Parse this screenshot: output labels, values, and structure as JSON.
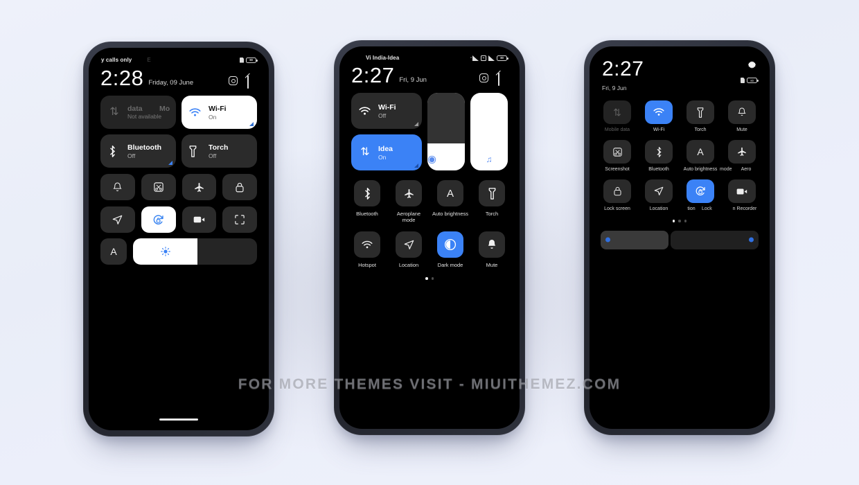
{
  "watermark": "FOR MORE THEMES VISIT - MIUITHEMEZ.COM",
  "phone1": {
    "statusbar": {
      "carrier": "y calls only",
      "ghost": "E",
      "battery_text": "80"
    },
    "header": {
      "time": "2:28",
      "date": "Friday, 09 June",
      "settings_icon": "hexagon-settings-icon",
      "edit_icon": "edit-icon"
    },
    "big_tiles": [
      {
        "name": "mobile-data",
        "ghost_a": "data",
        "ghost_b": "Mo",
        "title": "Mobile data",
        "subtitle": "Not available",
        "state": "dim",
        "icon": "data-arrows-icon",
        "corner": false
      },
      {
        "name": "wifi",
        "title": "Wi-Fi",
        "subtitle": "On",
        "state": "on-white",
        "icon": "wifi-icon",
        "corner": true
      },
      {
        "name": "bluetooth",
        "title": "Bluetooth",
        "subtitle": "Off",
        "state": "off",
        "icon": "bluetooth-icon",
        "corner": true
      },
      {
        "name": "torch",
        "title": "Torch",
        "subtitle": "Off",
        "state": "off",
        "icon": "torch-icon",
        "corner": false
      }
    ],
    "square_tiles": [
      {
        "name": "mute",
        "icon": "bell-icon",
        "on": false
      },
      {
        "name": "screenshot",
        "icon": "screenshot-icon",
        "on": false
      },
      {
        "name": "aeroplane-mode",
        "icon": "airplane-icon",
        "on": false
      },
      {
        "name": "lock-screen",
        "icon": "lock-icon",
        "on": false
      },
      {
        "name": "location",
        "icon": "location-arrow-icon",
        "on": false
      },
      {
        "name": "screen-rotation-lock",
        "icon": "rotation-lock-icon",
        "on": true
      },
      {
        "name": "screen-recorder",
        "icon": "video-camera-icon",
        "on": false
      },
      {
        "name": "scan",
        "icon": "scan-frame-icon",
        "on": false
      }
    ],
    "brightness": {
      "auto_label": "A",
      "icon": "brightness-icon",
      "fill_percent": 52
    }
  },
  "phone2": {
    "statusbar": {
      "carrier": "Vi India-Idea",
      "battery_text": "80"
    },
    "header": {
      "time": "2:27",
      "date": "Fri, 9 Jun",
      "settings_icon": "hexagon-settings-icon",
      "edit_icon": "edit-icon"
    },
    "big_tiles": [
      {
        "name": "wifi",
        "title": "Wi-Fi",
        "subtitle": "Off",
        "state": "off",
        "icon": "wifi-icon",
        "corner": true
      },
      {
        "name": "mobile-data-idea",
        "title": "Idea",
        "subtitle": "On",
        "state": "on-blue",
        "icon": "data-arrows-icon",
        "corner": true
      }
    ],
    "sliders": [
      {
        "name": "brightness-slider",
        "icon": "brightness-dot-icon",
        "fill_percent": 35
      },
      {
        "name": "volume-slider",
        "icon": "music-note-icon",
        "fill_percent": 100
      }
    ],
    "grid_tiles": [
      {
        "name": "bluetooth",
        "label": "Bluetooth",
        "icon": "bluetooth-icon",
        "on": false,
        "badge": true
      },
      {
        "name": "aeroplane-mode",
        "label": "Aeroplane mode",
        "icon": "airplane-icon",
        "on": false,
        "badge": false
      },
      {
        "name": "auto-brightness",
        "label": "Auto brightness",
        "icon": "auto-brightness-icon",
        "on": false,
        "badge": false
      },
      {
        "name": "torch",
        "label": "Torch",
        "icon": "torch-icon",
        "on": false,
        "badge": false
      },
      {
        "name": "hotspot",
        "label": "Hotspot",
        "icon": "hotspot-icon",
        "on": false,
        "badge": false
      },
      {
        "name": "location",
        "label": "Location",
        "icon": "location-arrow-icon",
        "on": false,
        "badge": false
      },
      {
        "name": "dark-mode",
        "label": "Dark mode",
        "icon": "dark-mode-icon",
        "on": true,
        "badge": false
      },
      {
        "name": "mute",
        "label": "Mute",
        "icon": "bell-icon",
        "on": false,
        "badge": false
      }
    ],
    "page_dots": {
      "count": 2,
      "active": 0
    }
  },
  "phone3": {
    "header": {
      "time": "2:27",
      "date": "Fri, 9 Jun",
      "settings_icon": "gear-icon",
      "battery_text": "80"
    },
    "grid_tiles": [
      {
        "name": "mobile-data",
        "label": "Mobile data",
        "icon": "data-arrows-icon",
        "state": "dim",
        "ghost_label": ""
      },
      {
        "name": "wifi",
        "label": "Wi-Fi",
        "icon": "wifi-icon",
        "state": "on",
        "ghost_label": ""
      },
      {
        "name": "torch",
        "label": "Torch",
        "icon": "torch-icon",
        "state": "off",
        "ghost_label": ""
      },
      {
        "name": "mute",
        "label": "Mute",
        "icon": "bell-icon",
        "state": "off",
        "ghost_label": ""
      },
      {
        "name": "screenshot",
        "label": "Screenshot",
        "icon": "screenshot-icon",
        "state": "off",
        "ghost_label": ""
      },
      {
        "name": "bluetooth",
        "label": "Bluetooth",
        "icon": "bluetooth-icon",
        "state": "off",
        "ghost_label": ""
      },
      {
        "name": "auto-brightness",
        "label": "Auto brightness",
        "icon": "auto-brightness-icon",
        "state": "off",
        "ghost_label": "mode"
      },
      {
        "name": "aeroplane-mode",
        "label": "Aero",
        "icon": "airplane-icon",
        "state": "off",
        "ghost_label": ""
      },
      {
        "name": "lock-screen",
        "label": "Lock screen",
        "icon": "lock-icon",
        "state": "off",
        "ghost_label": ""
      },
      {
        "name": "location",
        "label": "Location",
        "icon": "location-arrow-icon",
        "state": "off",
        "ghost_label": ""
      },
      {
        "name": "screen-rotation-lock",
        "label": "tion",
        "icon": "rotation-lock-icon",
        "state": "on",
        "ghost_label": "Lock"
      },
      {
        "name": "screen-recorder",
        "label": "n Recorder",
        "icon": "video-camera-icon",
        "state": "off",
        "ghost_label": ""
      }
    ],
    "page_dots": {
      "count": 3,
      "active": 0
    },
    "sliders": [
      {
        "name": "brightness-slider",
        "fill_percent": 43
      },
      {
        "name": "volume-slider",
        "fill_percent": 96
      }
    ]
  },
  "colors": {
    "accent": "#3b82f6",
    "screen_bg": "#000000",
    "tile_bg": "#2b2b2b",
    "page_bg": "#eef1fa"
  }
}
